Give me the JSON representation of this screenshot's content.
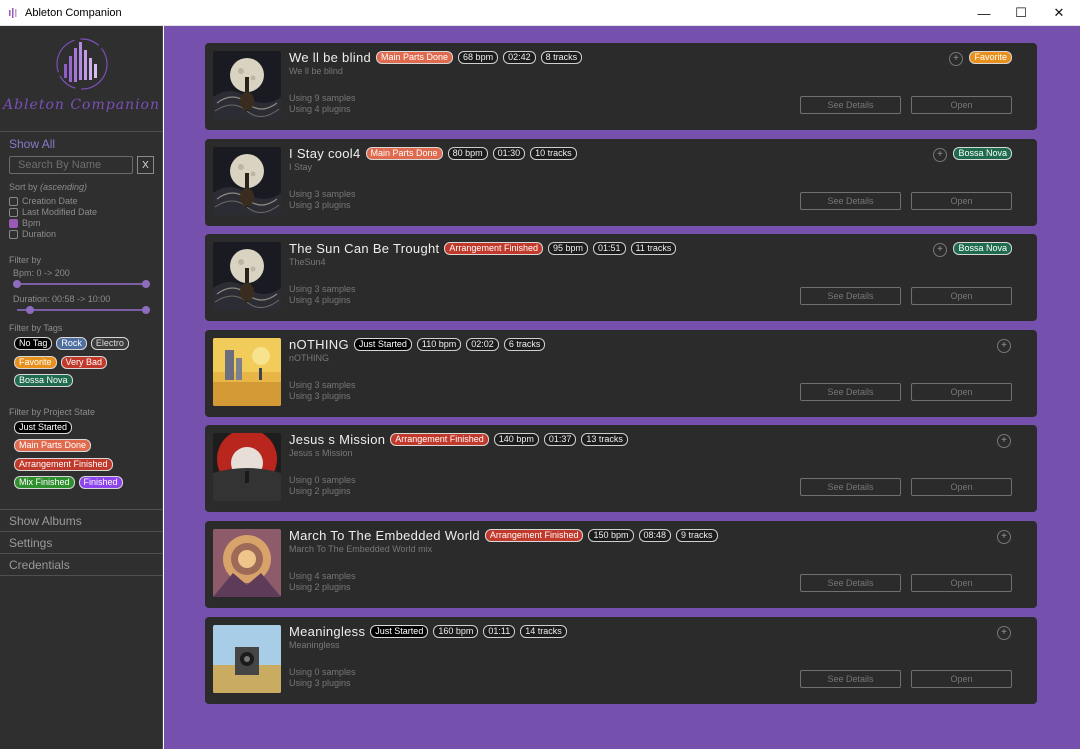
{
  "window": {
    "title": "Ableton Companion",
    "min": "—",
    "max": "☐",
    "close": "✕"
  },
  "sidebar": {
    "logo_text": "Ableton Companion",
    "show_all": "Show All",
    "search_placeholder": "Search By Name",
    "clear_label": "X",
    "sort_label": "Sort by",
    "sort_dir": "(ascending)",
    "sort_options": [
      "Creation Date",
      "Last Modified Date",
      "Bpm",
      "Duration"
    ],
    "sort_selected": 2,
    "filter_by": "Filter by",
    "bpm_range": "Bpm: 0 -> 200",
    "duration_range": "Duration: 00:58 -> 10:00",
    "filter_tags_label": "Filter by Tags",
    "tags": [
      {
        "label": "No Tag",
        "color": "#ffffff",
        "bg": "#000000"
      },
      {
        "label": "Rock",
        "color": "#ffffff",
        "bg": "#4e6fa0"
      },
      {
        "label": "Electro",
        "color": "#dddddd",
        "bg": "#3a3a3a"
      },
      {
        "label": "Favorite",
        "color": "#ffffff",
        "bg": "#e8901b"
      },
      {
        "label": "Very Bad",
        "color": "#ffffff",
        "bg": "#c0392b"
      },
      {
        "label": "Bossa Nova",
        "color": "#ffffff",
        "bg": "#1f6b4d"
      }
    ],
    "filter_state_label": "Filter by Project State",
    "states": [
      {
        "label": "Just Started",
        "color": "#ffffff",
        "bg": "#000000"
      },
      {
        "label": "Main Parts Done",
        "color": "#ffffff",
        "bg": "#e06a4e"
      },
      {
        "label": "Arrangement Finished",
        "color": "#ffffff",
        "bg": "#c0392b"
      },
      {
        "label": "Mix Finished",
        "color": "#ffffff",
        "bg": "#2f8f2f"
      },
      {
        "label": "Finished",
        "color": "#ffffff",
        "bg": "#8e44ec"
      }
    ],
    "menu": [
      "Show Albums",
      "Settings",
      "Credentials"
    ]
  },
  "projects": [
    {
      "title": "We ll be blind",
      "subtitle": "We ll be blind",
      "state": "Main Parts Done",
      "state_bg": "#e06a4e",
      "bpm": "68 bpm",
      "duration": "02:42",
      "tracks": "8 tracks",
      "samples": "Using 9 samples",
      "plugins": "Using 4 plugins",
      "tag": "Favorite",
      "tag_bg": "#e8901b",
      "art": "moon"
    },
    {
      "title": "I Stay cool4",
      "subtitle": "I Stay",
      "state": "Main Parts Done",
      "state_bg": "#e06a4e",
      "bpm": "80 bpm",
      "duration": "01:30",
      "tracks": "10 tracks",
      "samples": "Using 3 samples",
      "plugins": "Using 3 plugins",
      "tag": "Bossa Nova",
      "tag_bg": "#1f6b4d",
      "art": "moon"
    },
    {
      "title": "The Sun Can Be Trought",
      "subtitle": "TheSun4",
      "state": "Arrangement Finished",
      "state_bg": "#c0392b",
      "bpm": "95 bpm",
      "duration": "01:51",
      "tracks": "11 tracks",
      "samples": "Using 3 samples",
      "plugins": "Using 4 plugins",
      "tag": "Bossa Nova",
      "tag_bg": "#1f6b4d",
      "art": "moon"
    },
    {
      "title": "nOTHING",
      "subtitle": "nOTHING",
      "state": "Just Started",
      "state_bg": "#000000",
      "bpm": "110 bpm",
      "duration": "02:02",
      "tracks": "6 tracks",
      "samples": "Using 3 samples",
      "plugins": "Using 3 plugins",
      "tag": "",
      "tag_bg": "",
      "art": "desert"
    },
    {
      "title": "Jesus s Mission",
      "subtitle": "Jesus s Mission",
      "state": "Arrangement Finished",
      "state_bg": "#c0392b",
      "bpm": "140 bpm",
      "duration": "01:37",
      "tracks": "13 tracks",
      "samples": "Using 0 samples",
      "plugins": "Using 2 plugins",
      "tag": "",
      "tag_bg": "",
      "art": "red"
    },
    {
      "title": "March To The Embedded World",
      "subtitle": "March To The Embedded World mix",
      "state": "Arrangement Finished",
      "state_bg": "#c0392b",
      "bpm": "150 bpm",
      "duration": "08:48",
      "tracks": "9 tracks",
      "samples": "Using 4 samples",
      "plugins": "Using 2 plugins",
      "tag": "",
      "tag_bg": "",
      "art": "mandala"
    },
    {
      "title": "Meaningless",
      "subtitle": "Meaningless",
      "state": "Just Started",
      "state_bg": "#000000",
      "bpm": "160 bpm",
      "duration": "01:11",
      "tracks": "14 tracks",
      "samples": "Using 0 samples",
      "plugins": "Using 3 plugins",
      "tag": "",
      "tag_bg": "",
      "art": "speaker"
    }
  ],
  "labels": {
    "see_details": "See Details",
    "open": "Open",
    "plus": "+"
  }
}
